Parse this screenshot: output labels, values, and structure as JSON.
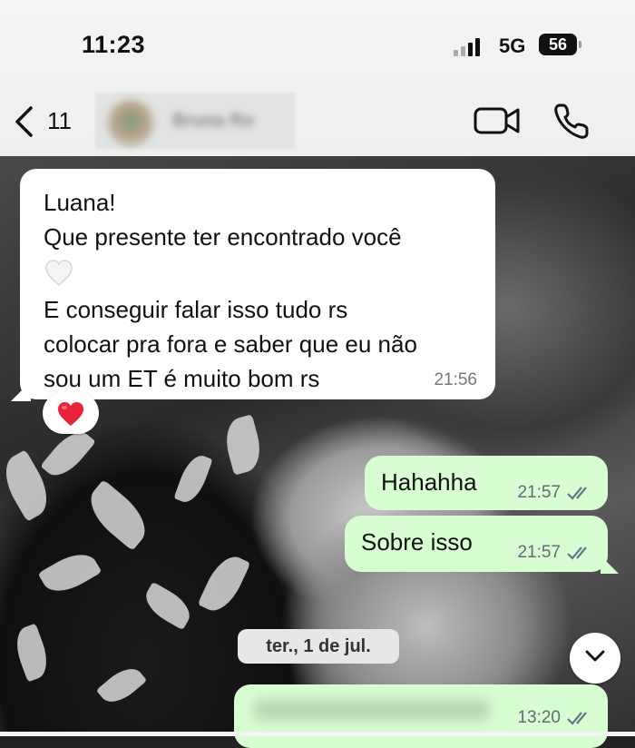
{
  "status_bar": {
    "time": "11:23",
    "network": "5G",
    "battery": "56"
  },
  "header": {
    "back_count": "11",
    "contact_name": "Bruna Ro",
    "icons": [
      "back-chevron-icon",
      "video-call-icon",
      "phone-call-icon"
    ]
  },
  "messages": [
    {
      "direction": "incoming",
      "lines": [
        "Luana!",
        "Que presente ter encontrado você",
        "E conseguir falar isso tudo rs",
        "colocar pra fora e saber que eu não",
        "sou um ET é muito bom rs"
      ],
      "time": "21:56",
      "reaction": "❤️"
    },
    {
      "direction": "outgoing",
      "text": "Hahahha",
      "time": "21:57",
      "status": "read"
    },
    {
      "direction": "outgoing",
      "text": "Sobre isso",
      "time": "21:57",
      "status": "read"
    },
    {
      "direction": "outgoing",
      "text": "",
      "time": "13:20",
      "status": "read"
    }
  ],
  "date_separator": "ter., 1 de jul.",
  "colors": {
    "incoming_bubble": "#ffffff",
    "outgoing_bubble": "#d9fdd3",
    "header_bg": "#f4f5f3",
    "read_ticks": "#667788"
  }
}
